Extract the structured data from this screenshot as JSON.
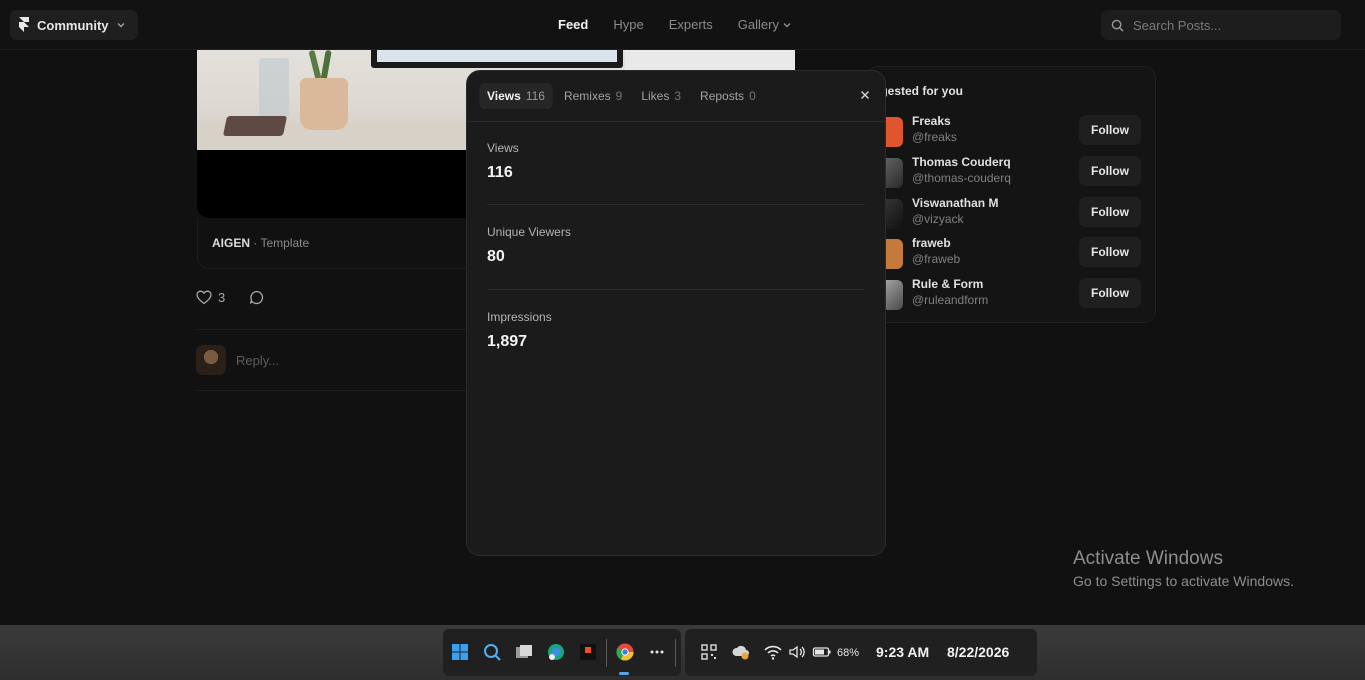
{
  "topbar": {
    "brand": "Community",
    "nav": [
      {
        "label": "Feed",
        "active": true
      },
      {
        "label": "Hype",
        "active": false
      },
      {
        "label": "Experts",
        "active": false
      },
      {
        "label": "Gallery",
        "active": false
      }
    ],
    "search_placeholder": "Search Posts..."
  },
  "post": {
    "author": "AIGEN",
    "type": "Template",
    "separator": "·",
    "likes": "3",
    "reply_placeholder": "Reply..."
  },
  "suggested": {
    "title": "ggested for you",
    "follow_label": "Follow",
    "users": [
      {
        "name": "Freaks",
        "handle": "@freaks",
        "color": "#e0542e"
      },
      {
        "name": "Thomas Couderq",
        "handle": "@thomas-couderq",
        "color": "#4a4a4a"
      },
      {
        "name": "Viswanathan M",
        "handle": "@vizyack",
        "color": "#2a2a2a"
      },
      {
        "name": "fraweb",
        "handle": "@fraweb",
        "color": "#c47a3c"
      },
      {
        "name": "Rule & Form",
        "handle": "@ruleandform",
        "color": "#8a8a8a"
      }
    ]
  },
  "modal": {
    "tabs": [
      {
        "label": "Views",
        "count": "116",
        "active": true
      },
      {
        "label": "Remixes",
        "count": "9",
        "active": false
      },
      {
        "label": "Likes",
        "count": "3",
        "active": false
      },
      {
        "label": "Reposts",
        "count": "0",
        "active": false
      }
    ],
    "stats": [
      {
        "label": "Views",
        "value": "116"
      },
      {
        "label": "Unique Viewers",
        "value": "80"
      },
      {
        "label": "Impressions",
        "value": "1,897"
      }
    ]
  },
  "watermark": {
    "line1": "Activate Windows",
    "line2": "Go to Settings to activate Windows."
  },
  "taskbar": {
    "battery": "68%",
    "time": "9:23 AM",
    "date": "8/22/2026"
  }
}
